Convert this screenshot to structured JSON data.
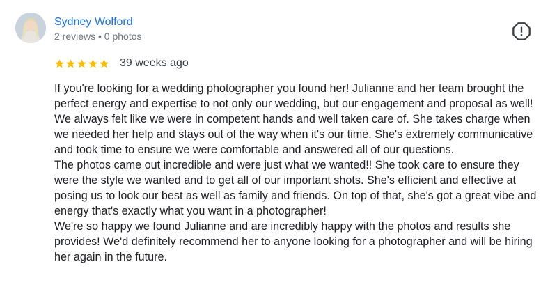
{
  "reviewer": {
    "name": "Sydney Wolford",
    "meta": "2 reviews • 0 photos"
  },
  "rating": {
    "stars": 5,
    "max": 5,
    "time": "39 weeks ago",
    "star_color": "#fbbc04"
  },
  "review": {
    "paragraphs": [
      "If you're looking for a wedding photographer you found her! Julianne and her team brought the perfect energy and expertise to not only our wedding, but our engagement and proposal as well! We always felt like we were in competent hands and well taken care of. She takes charge when we needed her help and stays out of the way when it's our time. She's extremely communicative and took time to ensure we were comfortable and answered all of our questions.",
      "The photos came out incredible and were just what we wanted!! She took care to ensure they were the style we wanted and to get all of our important shots. She's efficient and effective at posing us to look our best as well as family and friends. On top of that, she's got a great vibe and energy that's exactly what you want in a photographer!",
      "We're so happy we found Julianne and are incredibly happy with the photos and results she provides! We'd definitely recommend her to anyone looking for a photographer and will be hiring her again in the future."
    ]
  },
  "icons": {
    "report": "report-flag-icon",
    "star": "star-icon"
  },
  "colors": {
    "name_link": "#1a73e8",
    "meta_text": "#70757a"
  }
}
